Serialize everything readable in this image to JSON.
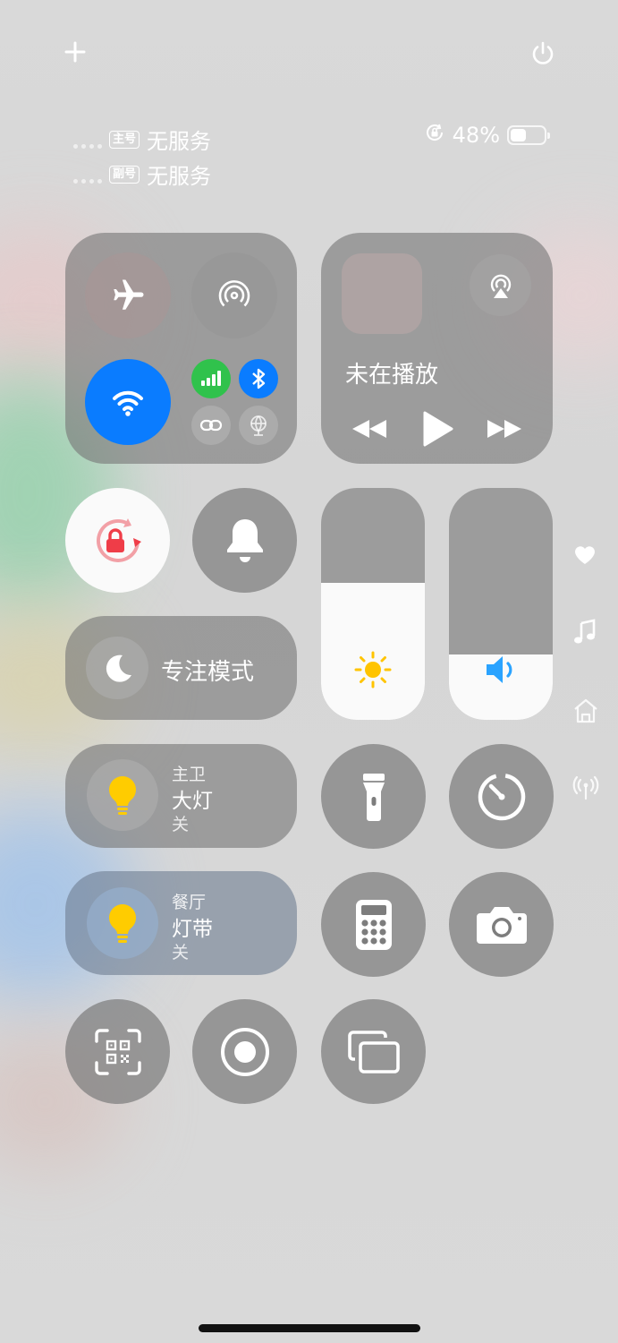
{
  "status": {
    "sim1_badge": "主号",
    "sim1_text": "无服务",
    "sim2_badge": "副号",
    "sim2_text": "无服务",
    "battery_percent_text": "48%",
    "battery_level": 0.48
  },
  "media": {
    "now_playing": "未在播放"
  },
  "focus": {
    "label": "专注模式"
  },
  "sliders": {
    "brightness_level": 0.59,
    "volume_level": 0.28
  },
  "devices": [
    {
      "room": "主卫",
      "name": "大灯",
      "state": "关"
    },
    {
      "room": "餐厅",
      "name": "灯带",
      "state": "关"
    }
  ],
  "colors": {
    "accent_blue": "#0a7cff",
    "cellular_green": "#30c24c",
    "bulb_yellow": "#ffcc00",
    "rotation_lock_red": "#ef3d48",
    "sun_yellow": "#ffc400",
    "speaker_blue": "#2aa3ff"
  },
  "icons": {
    "add": "plus-icon",
    "power": "power-icon",
    "airplane": "airplane-icon",
    "airdrop": "airdrop-icon",
    "wifi": "wifi-icon",
    "cellular": "cellular-icon",
    "bluetooth": "bluetooth-icon",
    "hotspot": "personal-hotspot-icon",
    "vpn": "globe-icon",
    "airplay": "airplay-icon",
    "rewind": "rewind-icon",
    "play": "play-icon",
    "forward": "fast-forward-icon",
    "rotation_lock": "rotation-lock-icon",
    "bell": "bell-icon",
    "moon": "moon-icon",
    "sun": "sun-icon",
    "speaker": "speaker-icon",
    "flashlight": "flashlight-icon",
    "timer": "timer-icon",
    "calculator": "calculator-icon",
    "camera": "camera-icon",
    "qr": "qr-scan-icon",
    "record": "screen-record-icon",
    "mirror": "screen-mirror-icon",
    "heart": "heart-icon",
    "music": "music-note-icon",
    "home": "home-icon",
    "antenna": "antenna-icon"
  }
}
